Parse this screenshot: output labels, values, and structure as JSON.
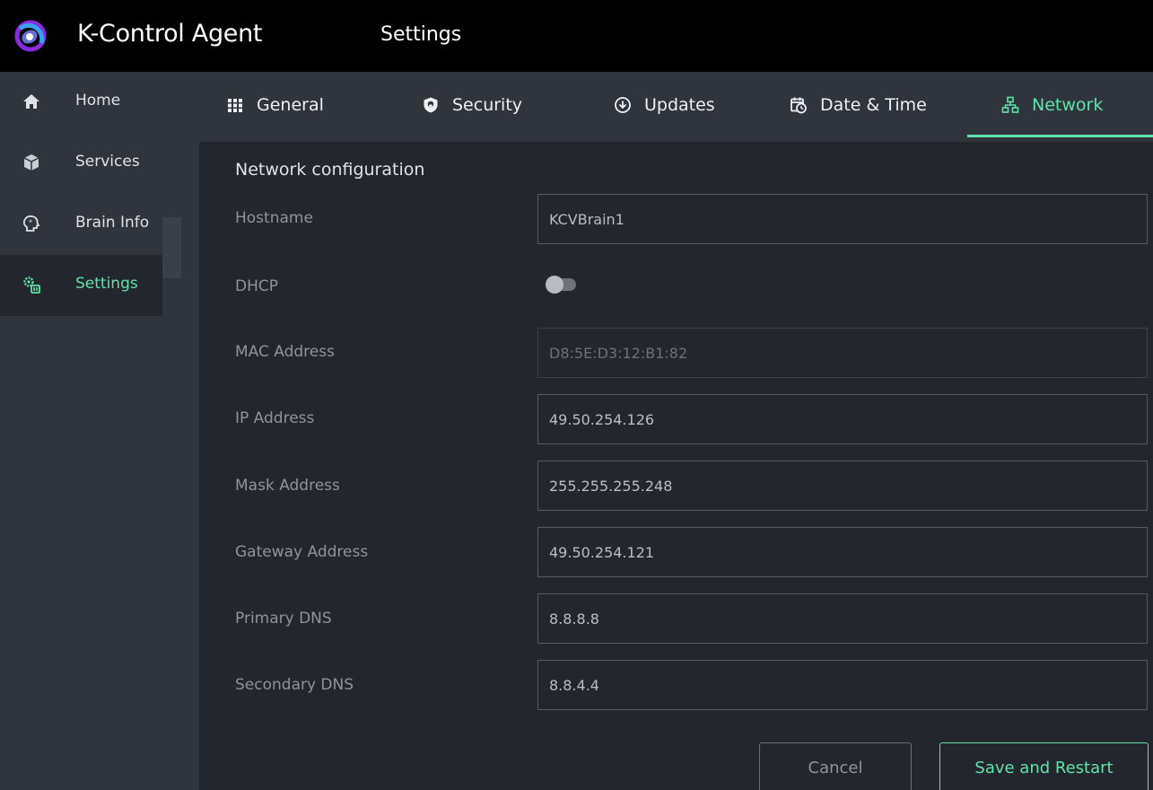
{
  "header": {
    "app_title": "K-Control Agent",
    "page_title": "Settings"
  },
  "sidebar": {
    "items": [
      {
        "label": "Home",
        "icon": "home-icon"
      },
      {
        "label": "Services",
        "icon": "cube-icon"
      },
      {
        "label": "Brain Info",
        "icon": "brain-icon"
      },
      {
        "label": "Settings",
        "icon": "gears-icon",
        "active": true
      }
    ]
  },
  "tabs": [
    {
      "label": "General",
      "icon": "grid-icon"
    },
    {
      "label": "Security",
      "icon": "shield-icon"
    },
    {
      "label": "Updates",
      "icon": "download-circle-icon"
    },
    {
      "label": "Date & Time",
      "icon": "calendar-clock-icon"
    },
    {
      "label": "Network",
      "icon": "network-icon",
      "active": true
    }
  ],
  "network": {
    "section_title": "Network configuration",
    "hostname": {
      "label": "Hostname",
      "value": "KCVBrain1"
    },
    "dhcp": {
      "label": "DHCP",
      "enabled": false
    },
    "mac": {
      "label": "MAC Address",
      "value": "D8:5E:D3:12:B1:82"
    },
    "ip": {
      "label": "IP Address",
      "value": "49.50.254.126"
    },
    "mask": {
      "label": "Mask Address",
      "value": "255.255.255.248"
    },
    "gateway": {
      "label": "Gateway Address",
      "value": "49.50.254.121"
    },
    "dns1": {
      "label": "Primary DNS",
      "value": "8.8.8.8"
    },
    "dns2": {
      "label": "Secondary DNS",
      "value": "8.8.4.4"
    }
  },
  "actions": {
    "cancel_label": "Cancel",
    "save_label": "Save and Restart"
  },
  "colors": {
    "accent": "#5ee4a9",
    "topbar": "#000000",
    "sidebar": "#30343c",
    "panel": "#23262d",
    "logo_outer": "#8a2be2",
    "logo_inner": "#6a6fd8"
  }
}
